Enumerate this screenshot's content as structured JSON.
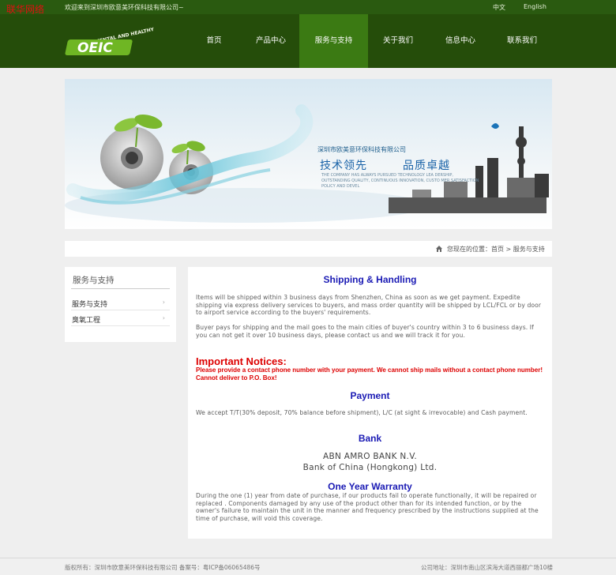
{
  "topbar": {
    "watermark": "联华网络",
    "welcome": "欢迎来到深圳市欧意美环保科技有限公司~",
    "lang_cn": "中文",
    "lang_en": "English"
  },
  "logo": {
    "arc_text": "ENVIRONMENTAL AND HEALTHY",
    "mark_text": "OEIC"
  },
  "nav": {
    "items": [
      {
        "label": "首页"
      },
      {
        "label": "产品中心"
      },
      {
        "label": "服务与支持",
        "active": true
      },
      {
        "label": "关于我们"
      },
      {
        "label": "信息中心"
      },
      {
        "label": "联系我们"
      }
    ]
  },
  "banner": {
    "company": "深圳市欧美意环保科技有限公司",
    "slogan1": "技术领先",
    "slogan2": "品质卓越",
    "tagline": "THE COMPANY HAS ALWAYS PURSUED TECHNOLOGY LEA DERSHIP, OUTSTANDING QUALITY, CONTINUOUS INNOVATION, CUSTO MER SATISFACTION POLICY AND DEVEL"
  },
  "breadcrumb": {
    "text": "您现在的位置：首页 > 服务与支持"
  },
  "sidebar": {
    "title": "服务与支持",
    "items": [
      {
        "label": "服务与支持"
      },
      {
        "label": "臭氧工程"
      }
    ]
  },
  "content": {
    "shipping_title": "Shipping & Handling",
    "shipping_p1": "Items will be shipped within 3 business days from Shenzhen, China as soon as we get payment. Expedite shipping via express delivery services to buyers, and mass order quantity will be shipped by LCL/FCL or by door to airport service according to the buyers' requirements.",
    "shipping_p2": "Buyer pays for shipping and the mail goes to the main cities of buyer's country within 3 to 6 business days. If you can not get it over 10 business days, please contact us and we will track it for you.",
    "important_title": "Important Notices:",
    "important_text": "Please provide a contact phone number with your payment. We cannot ship mails without a contact phone number! Cannot deliver to P.O. Box!",
    "payment_title": "Payment",
    "payment_text": "We accept T/T(30% deposit, 70% balance before shipment), L/C (at sight & irrevocable) and Cash payment.",
    "bank_title": "Bank",
    "bank1": "ABN AMRO BANK N.V.",
    "bank2": "Bank of China (Hongkong) Ltd.",
    "warranty_title": "One Year Warranty",
    "warranty_text": "During the one (1) year from date of purchase, if our products fail to operate functionally, it will be repaired or replaced . Components damaged by any use of the product other than for its intended function, or by the owner's failure to maintain the unit in the manner and frequency prescribed by the instructions supplied at the time of purchase, will void this coverage."
  },
  "footer": {
    "left": "版权所有：深圳市欧意美环保科技有限公司 备案号：粤ICP备06065486号",
    "right": "公司地址：深圳市南山区滨海大道西丽都广场10楼"
  },
  "colors": {
    "nav_bg": "#254d0a",
    "nav_active": "#3b7a13",
    "heading_blue": "#1a1ab4",
    "notice_red": "#dd0000"
  }
}
